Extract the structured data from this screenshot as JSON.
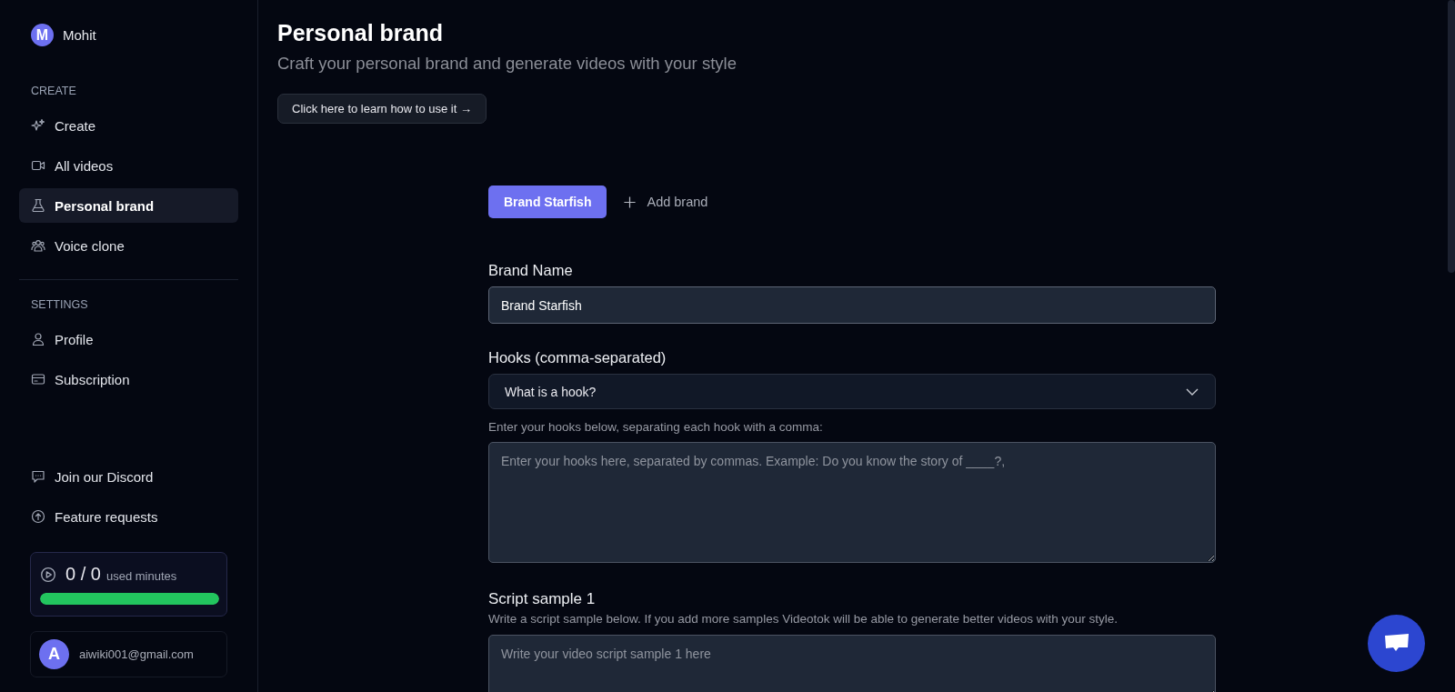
{
  "sidebar": {
    "user": {
      "initial": "M",
      "name": "Mohit"
    },
    "sections": [
      {
        "heading": "CREATE",
        "items": [
          {
            "label": "Create",
            "selected": false
          },
          {
            "label": "All videos",
            "selected": false
          },
          {
            "label": "Personal brand",
            "selected": true
          },
          {
            "label": "Voice clone",
            "selected": false
          }
        ]
      },
      {
        "heading": "SETTINGS",
        "items": [
          {
            "label": "Profile",
            "selected": false
          },
          {
            "label": "Subscription",
            "selected": false
          }
        ]
      }
    ],
    "footer_links": [
      {
        "label": "Join our Discord"
      },
      {
        "label": "Feature requests"
      }
    ],
    "usage": {
      "value": "0 / 0",
      "unit": "used minutes",
      "level": 1
    },
    "account": {
      "initial": "A",
      "email": "aiwiki001@gmail.com"
    }
  },
  "header": {
    "title": "Personal brand",
    "subtitle": "Craft your personal brand and generate videos with your style",
    "help_button": "Click here to learn how to use it →"
  },
  "brand_tabs": [
    {
      "label": "Brand Starfish",
      "selected": true
    }
  ],
  "add_brand": "Add brand",
  "form": {
    "brand_name": {
      "label": "Brand Name",
      "value": "Brand Starfish"
    },
    "hooks": {
      "label": "Hooks (comma-separated)",
      "dropdown": {
        "label": "What is a hook?",
        "expanded": false
      },
      "hint": "Enter your hooks below, separating each hook with a comma:",
      "placeholder": "Enter your hooks here, separated by commas. Example: Do you know the story of ____?,"
    },
    "script_sample": {
      "label": "Script sample 1",
      "hint": "Write a script sample below. If you add more samples Videotok will be able to generate better videos with your style.",
      "placeholder": "Write your video script sample 1 here"
    }
  }
}
